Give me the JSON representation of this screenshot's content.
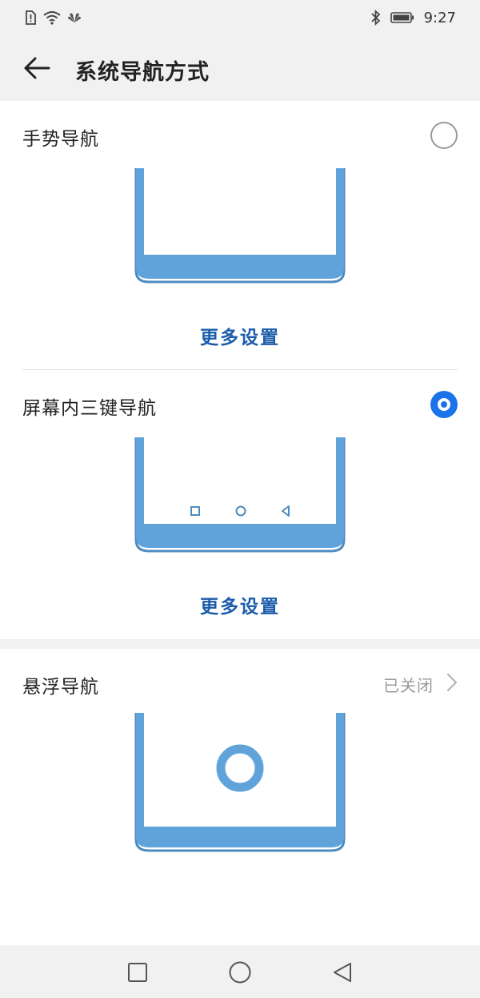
{
  "status_bar": {
    "time": "9:27"
  },
  "header": {
    "title": "系统导航方式"
  },
  "options": [
    {
      "label": "手势导航",
      "more_settings": "更多设置",
      "selected": false
    },
    {
      "label": "屏幕内三键导航",
      "more_settings": "更多设置",
      "selected": true
    }
  ],
  "floating": {
    "label": "悬浮导航",
    "status": "已关闭"
  },
  "colors": {
    "accent": "#1a73e8",
    "link": "#1b5cab",
    "phone_outline": "#5fa3da",
    "phone_base": "#4d8cc0",
    "background": "#f1f1f1",
    "card": "#ffffff"
  },
  "icons": {
    "back": "arrow-left-icon",
    "bluetooth": "bluetooth-icon",
    "battery": "battery-icon",
    "wifi": "wifi-icon",
    "chevron": "chevron-right-icon",
    "nav_square": "square-icon",
    "nav_circle": "circle-icon",
    "nav_triangle": "triangle-back-icon"
  }
}
